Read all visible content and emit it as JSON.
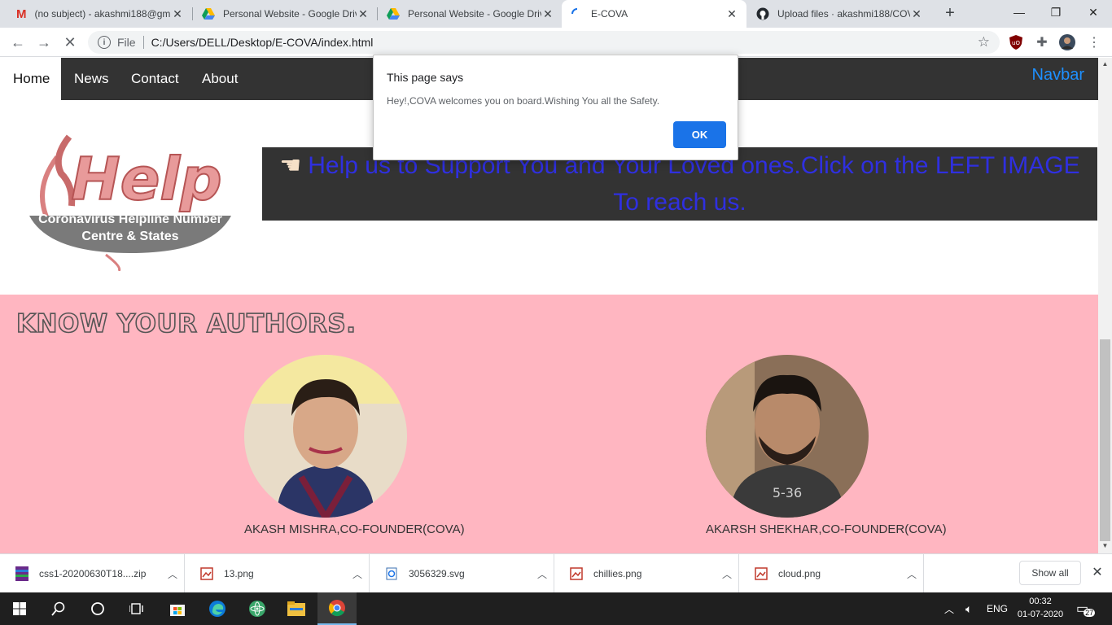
{
  "browser": {
    "tabs": [
      {
        "title": "(no subject) - akashmi188@gm",
        "icon": "gmail-icon"
      },
      {
        "title": "Personal Website - Google Driv",
        "icon": "google-drive-icon"
      },
      {
        "title": "Personal Website - Google Driv",
        "icon": "google-drive-icon"
      },
      {
        "title": "E-COVA",
        "icon": "loading-icon"
      },
      {
        "title": "Upload files · akashmi188/COV",
        "icon": "github-icon"
      }
    ],
    "active_tab": 3,
    "omnibox": {
      "scheme_label": "File",
      "url": "C:/Users/DELL/Desktop/E-COVA/index.html"
    }
  },
  "page": {
    "navbar": {
      "items": [
        "Home",
        "News",
        "Contact",
        "About"
      ],
      "active": "Home",
      "brand": "Navbar"
    },
    "helpline_image": {
      "word": "Help",
      "caption_line1": "Coronavirus Helpline Number",
      "caption_line2": "Centre & States"
    },
    "banner": {
      "icon": "pointing-hand-icon",
      "text": "Help us to Support You and Your Loved ones.Click on the LEFT IMAGE To reach us."
    },
    "authors": {
      "title": "KNOW YOUR AUTHORS.",
      "people": [
        {
          "name": "AKASH MISHRA,CO-FOUNDER(COVA)"
        },
        {
          "name": "AKARSH SHEKHAR,CO-FOUNDER(COVA)"
        }
      ]
    },
    "colors": {
      "navbar_bg": "#333333",
      "authors_bg": "#ffb6c1",
      "banner_text": "#2f2fe0",
      "brand": "#1e90ff"
    }
  },
  "dialog": {
    "title": "This page says",
    "message": "Hey!,COVA welcomes you on board.Wishing You all the Safety.",
    "ok_label": "OK"
  },
  "downloads": {
    "items": [
      {
        "name": "css1-20200630T18....zip",
        "icon": "archive-icon"
      },
      {
        "name": "13.png",
        "icon": "image-file-icon"
      },
      {
        "name": "3056329.svg",
        "icon": "svg-file-icon"
      },
      {
        "name": "chillies.png",
        "icon": "image-file-icon"
      },
      {
        "name": "cloud.png",
        "icon": "image-file-icon"
      }
    ],
    "show_all_label": "Show all"
  },
  "taskbar": {
    "language": "ENG",
    "time": "00:32",
    "date": "01-07-2020",
    "notification_count": "27"
  }
}
